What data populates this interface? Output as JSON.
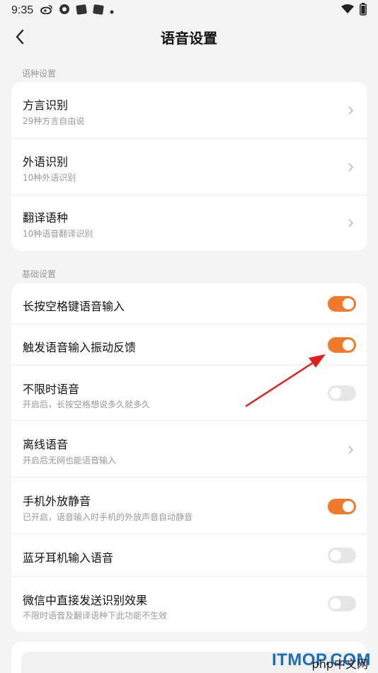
{
  "status_bar": {
    "time": "9:35",
    "icons": [
      "weibo-icon",
      "app-icon",
      "app-icon",
      "app-icon",
      "dot-icon"
    ],
    "right_icons": [
      "wifi-icon",
      "battery-icon"
    ]
  },
  "header": {
    "title": "语音设置"
  },
  "sections": {
    "language": {
      "label": "语种设置",
      "items": [
        {
          "title": "方言识别",
          "subtitle": "29种方言自由说"
        },
        {
          "title": "外语识别",
          "subtitle": "10种外语识别"
        },
        {
          "title": "翻译语种",
          "subtitle": "10种语音翻译识别"
        }
      ]
    },
    "basic": {
      "label": "基础设置",
      "items": [
        {
          "title": "长按空格键语音输入",
          "subtitle": "",
          "control": "toggle",
          "on": true
        },
        {
          "title": "触发语音输入振动反馈",
          "subtitle": "",
          "control": "toggle",
          "on": true
        },
        {
          "title": "不限时语音",
          "subtitle": "开启后，长按空格想说多久就多久",
          "control": "toggle",
          "on": false
        },
        {
          "title": "离线语音",
          "subtitle": "开启后无网也能语音输入",
          "control": "chevron"
        },
        {
          "title": "手机外放静音",
          "subtitle": "已开启，语音输入时手机的外放声音自动静音",
          "control": "toggle",
          "on": true
        },
        {
          "title": "蓝牙耳机输入语音",
          "subtitle": "",
          "control": "toggle",
          "on": false
        },
        {
          "title": "微信中直接发送识别效果",
          "subtitle": "不限时语音及翻译语种下此功能不生效",
          "control": "toggle",
          "on": false
        }
      ]
    }
  },
  "watermark": {
    "text": "ITMOP.COM",
    "php": "php",
    "cn": "中文网"
  },
  "colors": {
    "accent": "#f07a2c",
    "toggle_off": "#e6e6e6",
    "annotation_arrow": "#e02020"
  }
}
